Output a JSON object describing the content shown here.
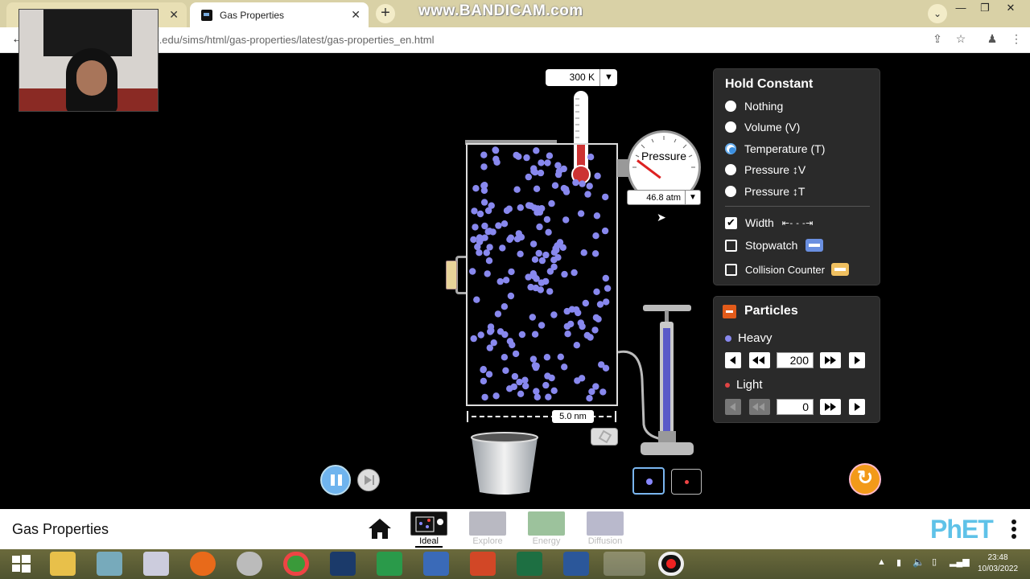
{
  "browser": {
    "tabs": [
      {
        "label": "",
        "active": false
      },
      {
        "label": "Gas Properties",
        "active": true
      }
    ],
    "watermark": "www.BANDICAM.com",
    "url_visible": "ado.edu/sims/html/gas-properties/latest/gas-properties_en.html"
  },
  "sim": {
    "temperature": "300 K",
    "pressure_gauge_label": "Pressure",
    "pressure": "46.8 atm",
    "width": "5.0 nm"
  },
  "hold_constant": {
    "title": "Hold Constant",
    "options": [
      {
        "label": "Nothing",
        "selected": false
      },
      {
        "label": "Volume (V)",
        "selected": false
      },
      {
        "label": "Temperature (T)",
        "selected": true
      },
      {
        "label": "Pressure ↕V",
        "selected": false
      },
      {
        "label": "Pressure ↕T",
        "selected": false
      }
    ],
    "tools": [
      {
        "label": "Width",
        "checked": true
      },
      {
        "label": "Stopwatch",
        "checked": false
      },
      {
        "label": "Collision Counter",
        "checked": false
      }
    ]
  },
  "particles": {
    "title": "Particles",
    "heavy": {
      "label": "Heavy",
      "count": "200",
      "color": "#8888ee"
    },
    "light": {
      "label": "Light",
      "count": "0",
      "color": "#e04444"
    }
  },
  "nav": {
    "sim_title": "Gas Properties",
    "screens": [
      {
        "label": "Ideal",
        "active": true
      },
      {
        "label": "Explore",
        "active": false
      },
      {
        "label": "Energy",
        "active": false
      },
      {
        "label": "Diffusion",
        "active": false
      }
    ],
    "logo": "PhET"
  },
  "taskbar": {
    "time": "23:48",
    "date": "10/03/2022"
  }
}
